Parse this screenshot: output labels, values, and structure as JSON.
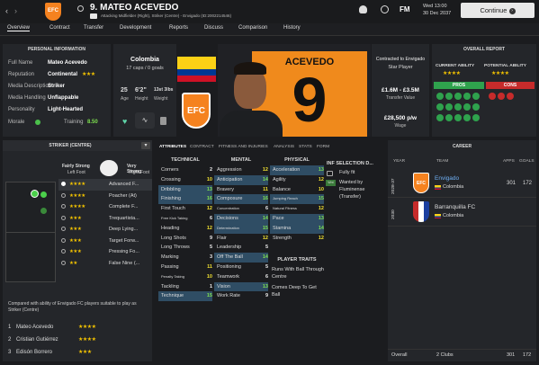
{
  "header": {
    "shirt_number_name": "9. MATEO ACEVEDO",
    "subtitle": "Attacking Midfielder (Right), Striker (Centre) - Envigado (ID:2002214546)",
    "crest_text": "EFC",
    "fm_label": "FM",
    "time": "Wed 13:00",
    "date": "30 Dec 2037",
    "continue_label": "Continue"
  },
  "nav": [
    "Overview",
    "Contract",
    "Transfer",
    "Development",
    "Reports",
    "Discuss",
    "Comparison",
    "History"
  ],
  "personal": {
    "title": "PERSONAL INFORMATION",
    "rows": [
      {
        "label": "Full Name",
        "value": "Mateo Acevedo"
      },
      {
        "label": "Reputation",
        "value": "Continental"
      },
      {
        "label": "Media Description",
        "value": "Striker"
      },
      {
        "label": "Media Handling",
        "value": "Unflappable"
      },
      {
        "label": "Personality",
        "value": "Light-Hearted"
      }
    ],
    "morale_label": "Morale",
    "training_label": "Training",
    "training_value": "8.50"
  },
  "nation": {
    "name": "Colombia",
    "caps": "17 caps / 0 goals",
    "age": "25",
    "age_label": "Age",
    "height": "6'2\"",
    "height_label": "Height",
    "weight": "13st 3lbs",
    "weight_label": "Weight"
  },
  "shirt": {
    "name": "ACEVEDO",
    "number": "9"
  },
  "contract": {
    "status": "Contracted to Envigado",
    "role": "Star Player",
    "value": "£1.6M - £3.5M",
    "value_label": "Transfer Value",
    "wage": "£28,500 p/w",
    "wage_label": "Wage"
  },
  "report": {
    "title": "OVERALL REPORT",
    "ca_label": "CURRENT ABILITY",
    "pa_label": "POTENTIAL ABILITY",
    "pros_label": "PROS",
    "cons_label": "CONS"
  },
  "positions": {
    "header": "STRIKER (CENTRE)",
    "left_foot": "Fairly Strong",
    "left_foot_label": "Left Foot",
    "right_foot": "Very Strong",
    "right_foot_label": "Right Foot",
    "roles": [
      "Advanced F...",
      "Poacher (At)",
      "Complete F...",
      "Trequartista...",
      "Deep Lying...",
      "Target Forw...",
      "Pressing Fo...",
      "False Nine (..."
    ],
    "compare_note": "Compared with ability of Envigado FC players suitable to play as Striker (Centre)",
    "players": [
      {
        "rank": "1",
        "name": "Mateo Acevedo"
      },
      {
        "rank": "2",
        "name": "Cristian Gutiérrez"
      },
      {
        "rank": "3",
        "name": "Edisón Borrero"
      }
    ]
  },
  "tabs": [
    "ATTRIBUTES",
    "CONTRACT",
    "FITNESS AND INJURIES",
    "ANALYSIS",
    "STATS",
    "FORM"
  ],
  "attributes": {
    "technical_title": "TECHNICAL",
    "mental_title": "MENTAL",
    "physical_title": "PHYSICAL",
    "technical": [
      {
        "n": "Corners",
        "v": "2"
      },
      {
        "n": "Crossing",
        "v": "10"
      },
      {
        "n": "Dribbling",
        "v": "13"
      },
      {
        "n": "Finishing",
        "v": "16"
      },
      {
        "n": "First Touch",
        "v": "12"
      },
      {
        "n": "Free Kick Taking",
        "v": "6"
      },
      {
        "n": "Heading",
        "v": "12"
      },
      {
        "n": "Long Shots",
        "v": "9"
      },
      {
        "n": "Long Throws",
        "v": "5"
      },
      {
        "n": "Marking",
        "v": "3"
      },
      {
        "n": "Passing",
        "v": "11"
      },
      {
        "n": "Penalty Taking",
        "v": "10"
      },
      {
        "n": "Tackling",
        "v": "1"
      },
      {
        "n": "Technique",
        "v": "15"
      }
    ],
    "mental": [
      {
        "n": "Aggression",
        "v": "12"
      },
      {
        "n": "Anticipation",
        "v": "14"
      },
      {
        "n": "Bravery",
        "v": "11"
      },
      {
        "n": "Composure",
        "v": "16"
      },
      {
        "n": "Concentration",
        "v": "6"
      },
      {
        "n": "Decisions",
        "v": "14"
      },
      {
        "n": "Determination",
        "v": "15"
      },
      {
        "n": "Flair",
        "v": "12"
      },
      {
        "n": "Leadership",
        "v": "5"
      },
      {
        "n": "Off The Ball",
        "v": "14"
      },
      {
        "n": "Positioning",
        "v": "5"
      },
      {
        "n": "Teamwork",
        "v": "6"
      },
      {
        "n": "Vision",
        "v": "13"
      },
      {
        "n": "Work Rate",
        "v": "9"
      }
    ],
    "physical": [
      {
        "n": "Acceleration",
        "v": "13"
      },
      {
        "n": "Agility",
        "v": "12"
      },
      {
        "n": "Balance",
        "v": "10"
      },
      {
        "n": "Jumping Reach",
        "v": "15"
      },
      {
        "n": "Natural Fitness",
        "v": "12"
      },
      {
        "n": "Pace",
        "v": "13"
      },
      {
        "n": "Stamina",
        "v": "14"
      },
      {
        "n": "Strength",
        "v": "12"
      }
    ],
    "traits_title": "PLAYER TRAITS",
    "traits": [
      "Runs With Ball Through Centre",
      "Comes Deep To Get Ball"
    ]
  },
  "selection": {
    "title": "INF SELECTION D...",
    "fit": "Fully fit",
    "badge": "Wnt",
    "wanted": "Wanted by Fluminense (Transfer)"
  },
  "career": {
    "title": "CAREER",
    "col_year": "YEAR",
    "col_team": "TEAM",
    "col_apps": "APPS",
    "col_goals": "GOALS",
    "rows": [
      {
        "years": "2028-37",
        "team": "Envigado",
        "country": "Colombia",
        "apps": "301",
        "goals": "172"
      },
      {
        "years": "2030",
        "team": "Barranquilla FC",
        "country": "Colombia",
        "apps": "",
        "goals": ""
      }
    ],
    "overall_label": "Overall",
    "overall_clubs": "2 Clubs",
    "overall_apps": "301",
    "overall_goals": "172"
  }
}
